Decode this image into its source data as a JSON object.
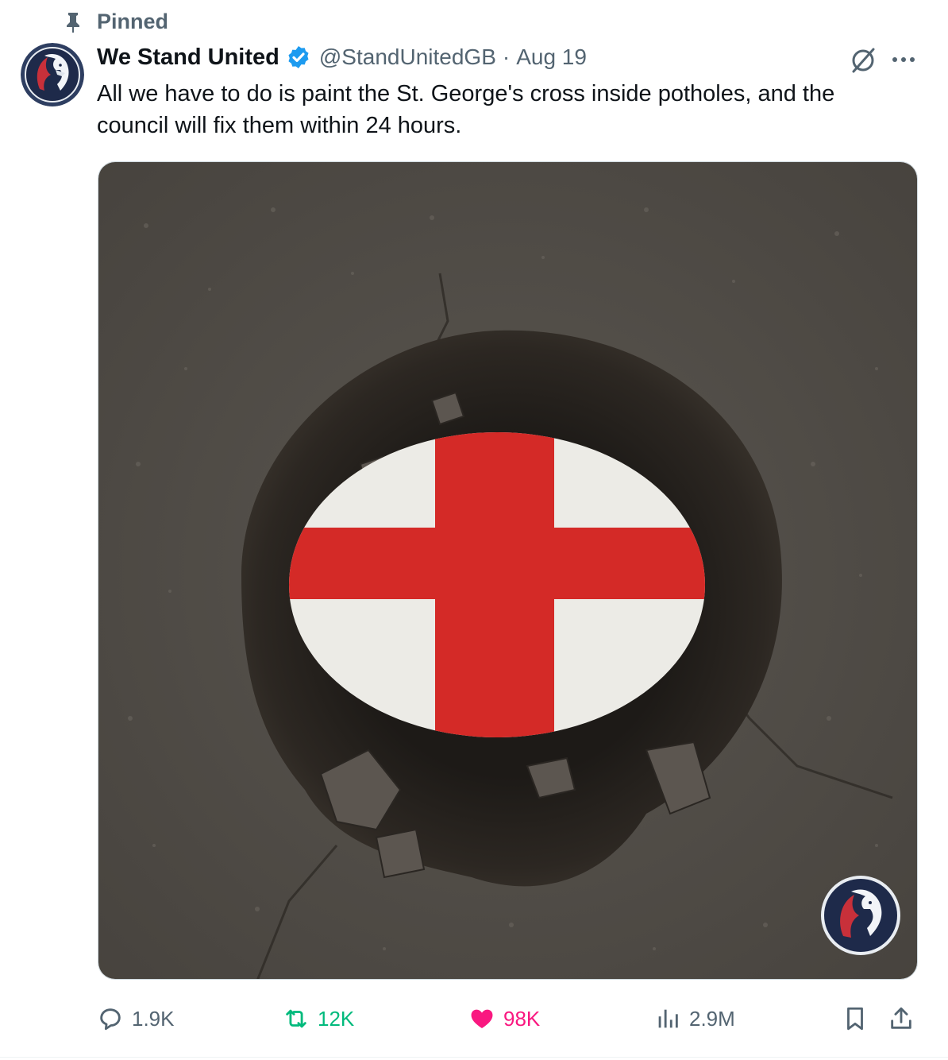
{
  "social_context": {
    "label": "Pinned",
    "icon": "pin-icon"
  },
  "author": {
    "name": "We Stand United",
    "verified": true,
    "handle": "@StandUnitedGB",
    "separator": "·",
    "date": "Aug 19"
  },
  "tweet": {
    "text": "All we have to do is paint the St. George's cross inside potholes, and the council will fix them within 24 hours."
  },
  "media": {
    "description_icon": "pothole-st-george-cross-image",
    "watermark_icon": "lion-logo-icon"
  },
  "actions": {
    "replies": "1.9K",
    "reposts": "12K",
    "likes": "98K",
    "views": "2.9M"
  },
  "colors": {
    "text_primary": "#0f1419",
    "text_secondary": "#536471",
    "verified_blue": "#1d9bf0",
    "repost_green": "#00ba7c",
    "like_pink": "#f91880",
    "flag_red": "#d42a27",
    "asphalt": "#4f4b46"
  }
}
